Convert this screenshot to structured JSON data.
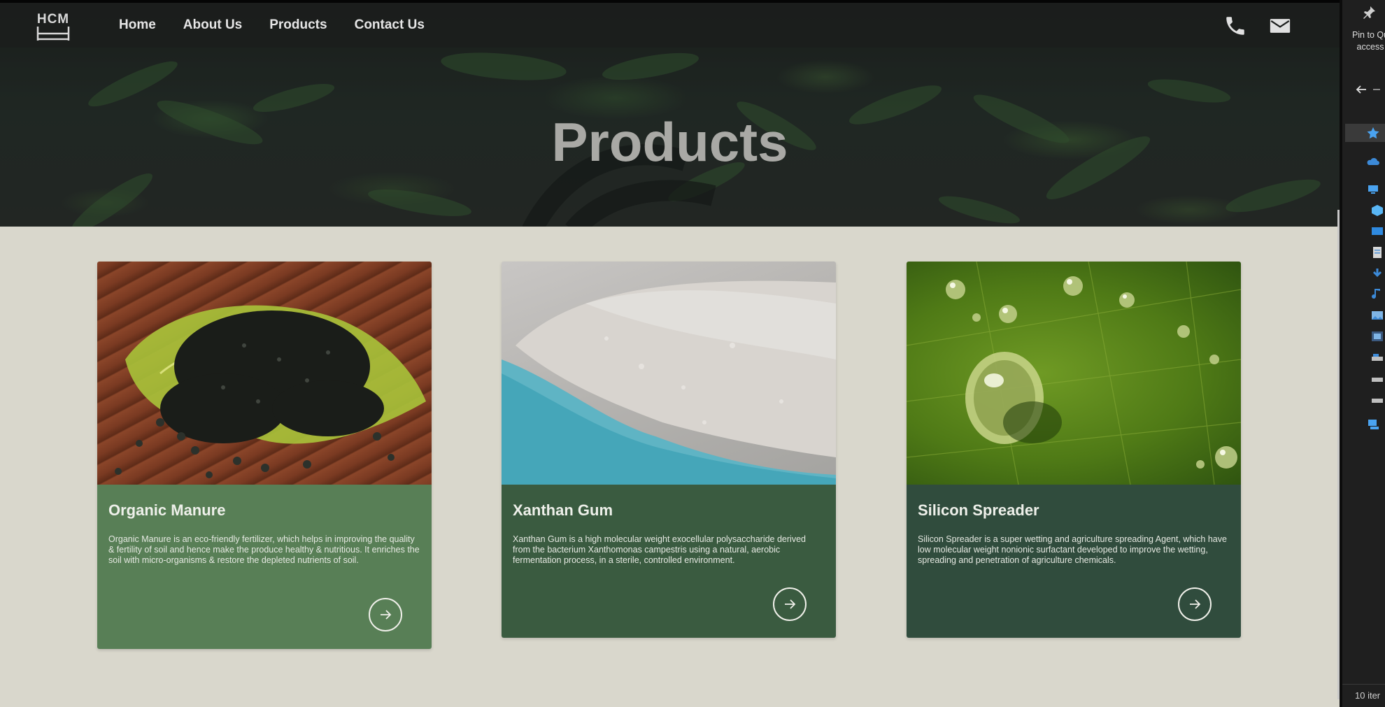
{
  "nav": {
    "logo_text": "HCM",
    "links": [
      "Home",
      "About Us",
      "Products",
      "Contact Us"
    ],
    "icons": [
      "phone-icon",
      "mail-icon"
    ]
  },
  "hero": {
    "title": "Products"
  },
  "products": [
    {
      "title": "Organic Manure",
      "description": "Organic Manure is an eco-friendly fertilizer, which helps in improving the quality & fertility of soil and hence make the produce healthy & nutritious. It enriches the soil with micro-organisms & restore the depleted nutrients of soil.",
      "color": "#587f56"
    },
    {
      "title": "Xanthan Gum",
      "description": "Xanthan Gum is a high molecular weight exocellular polysaccharide derived from the bacterium Xanthomonas campestris using a natural, aerobic fermentation process, in a sterile, controlled environment.",
      "color": "#3a5b40"
    },
    {
      "title": "Silicon Spreader",
      "description": "Silicon Spreader is a super wetting and agriculture spreading Agent, which have low molecular weight nonionic surfactant developed to improve the wetting, spreading and penetration of agriculture chemicals.",
      "color": "#304c3d"
    }
  ],
  "explorer": {
    "pin_text": "Pin to Qu access",
    "status": "10 iter"
  }
}
